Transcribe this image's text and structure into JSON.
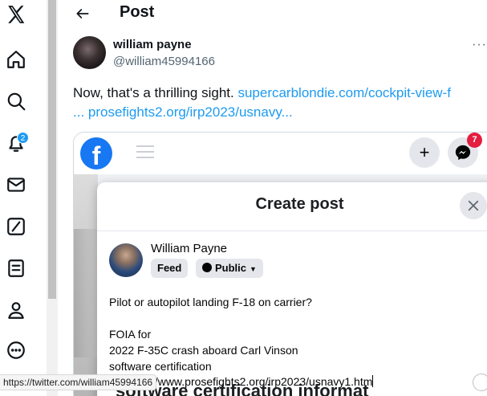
{
  "nav": {
    "notifications_badge": "2"
  },
  "header": {
    "title": "Post"
  },
  "tweet": {
    "author_name": "william payne",
    "author_handle": "@william45994166",
    "more": "···",
    "text_prefix": "Now, that's a thrilling sight. ",
    "link1": "supercarblondie.com/cockpit-view-f",
    "ellipsis": "... ",
    "link2": "prosefights2.org/irp2023/usnavy..."
  },
  "embed": {
    "fb_logo": "f",
    "plus": "+",
    "messenger_badge": "7",
    "dialog": {
      "title": "Create post",
      "user_name": "William Payne",
      "feed_label": "Feed",
      "privacy_label": "Public",
      "lines": [
        "Pilot or autopilot landing F-18 on carrier?",
        "",
        "FOIA for",
        "2022 F-35C crash aboard Carl Vinson",
        "software certification"
      ],
      "url_line": "ionhttps://www.prosefights2.org/irp2023/usnavy1.htm"
    },
    "background_text": "software certification informat"
  },
  "status_bar": {
    "url": "https://twitter.com/william45994166"
  },
  "colors": {
    "accent": "#1d9bf0",
    "facebook_blue": "#1877f2",
    "messenger_badge": "#e41e3f"
  }
}
